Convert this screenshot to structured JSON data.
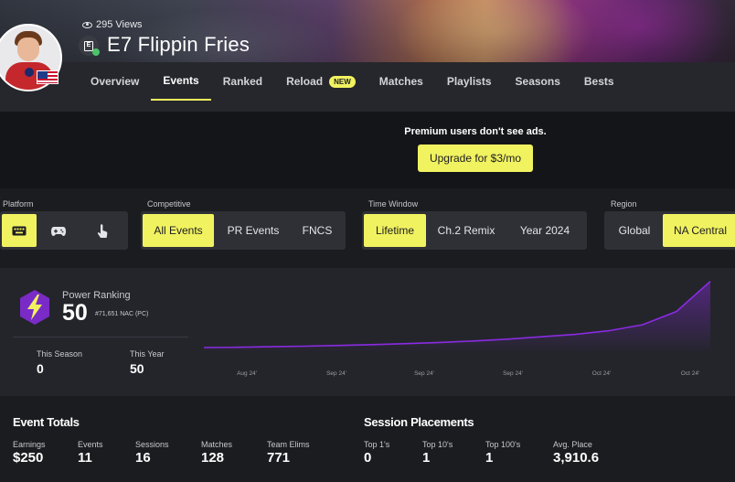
{
  "header": {
    "views": "295 Views",
    "title": "E7 Flippin Fries"
  },
  "tabs": [
    {
      "label": "Overview"
    },
    {
      "label": "Events"
    },
    {
      "label": "Ranked"
    },
    {
      "label": "Reload",
      "badge": "NEW"
    },
    {
      "label": "Matches"
    },
    {
      "label": "Playlists"
    },
    {
      "label": "Seasons"
    },
    {
      "label": "Bests"
    }
  ],
  "active_tab": "Events",
  "ad": {
    "message": "Premium users don't see ads.",
    "button": "Upgrade for $3/mo"
  },
  "filters": {
    "platform": {
      "label": "Platform",
      "options": [
        "keyboard-icon",
        "gamepad-icon",
        "touch-icon"
      ],
      "selected": "keyboard-icon"
    },
    "competitive": {
      "label": "Competitive",
      "options": [
        "All Events",
        "PR Events",
        "FNCS"
      ],
      "selected": "All Events"
    },
    "time_window": {
      "label": "Time Window",
      "options": [
        "Lifetime",
        "Ch.2 Remix",
        "Year 2024"
      ],
      "selected": "Lifetime"
    },
    "region": {
      "label": "Region",
      "options": [
        "Global",
        "NA Central"
      ],
      "selected": "NA Central"
    }
  },
  "power_ranking": {
    "label": "Power Ranking",
    "value": "50",
    "rank": "#71,651 NAC (PC)",
    "this_season_label": "This Season",
    "this_season_value": "0",
    "this_year_label": "This Year",
    "this_year_value": "50"
  },
  "chart_data": {
    "type": "area",
    "x_ticks": [
      "Aug 24'",
      "Sep 24'",
      "Sep 24'",
      "Sep 24'",
      "Oct 24'",
      "Oct 24'"
    ],
    "series": [
      {
        "values": [
          3,
          3.3,
          3.7,
          4.2,
          4.8,
          5.5,
          6.3,
          7.3,
          8.5,
          10,
          12,
          14,
          17,
          22,
          33,
          58
        ]
      }
    ],
    "ylim": [
      0,
      60
    ],
    "grid": false,
    "color": "#8a2be2"
  },
  "event_totals": {
    "title": "Event Totals",
    "items": [
      {
        "label": "Earnings",
        "value": "$250"
      },
      {
        "label": "Events",
        "value": "11"
      },
      {
        "label": "Sessions",
        "value": "16"
      },
      {
        "label": "Matches",
        "value": "128"
      },
      {
        "label": "Team Elims",
        "value": "771"
      }
    ]
  },
  "session_placements": {
    "title": "Session Placements",
    "items": [
      {
        "label": "Top 1's",
        "value": "0"
      },
      {
        "label": "Top 10's",
        "value": "1"
      },
      {
        "label": "Top 100's",
        "value": "1"
      },
      {
        "label": "Avg. Place",
        "value": "3,910.6"
      }
    ]
  },
  "colors": {
    "accent": "#f1f260",
    "background": "#1b1c20",
    "card": "#24252b",
    "chart_line": "#8a2be2"
  }
}
